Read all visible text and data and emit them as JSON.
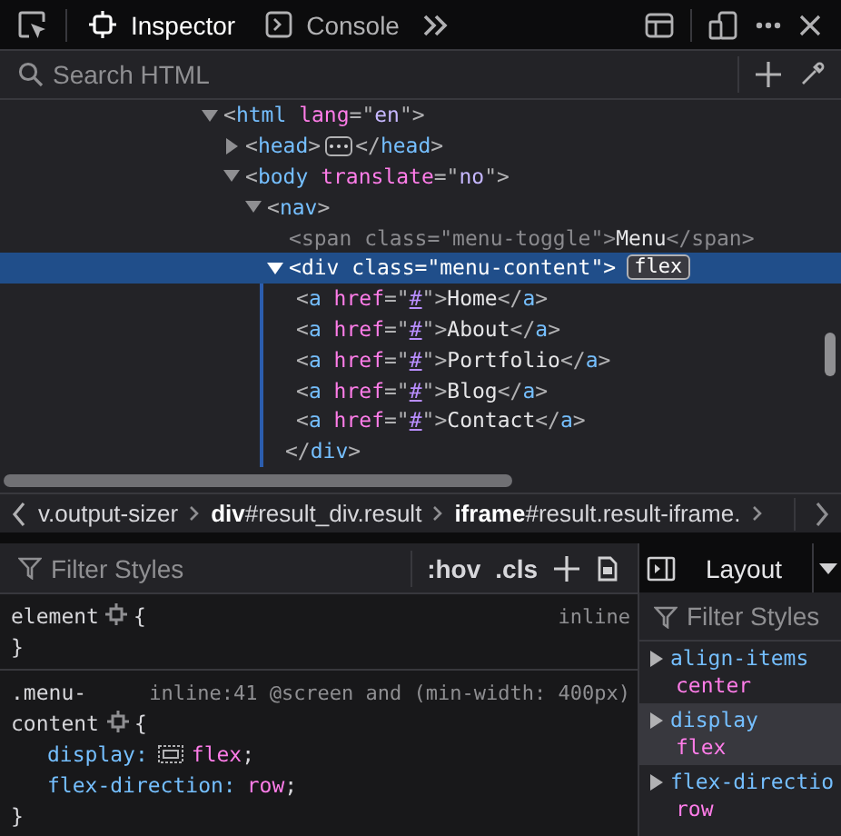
{
  "toolbar": {
    "tabs": [
      {
        "label": "Inspector",
        "selected": true
      },
      {
        "label": "Console",
        "selected": false
      }
    ]
  },
  "search": {
    "placeholder": "Search HTML"
  },
  "markup": {
    "nodes": [
      {
        "tokens": [
          {
            "kind": "p",
            "text": "<"
          },
          {
            "kind": "tag",
            "text": "html"
          },
          {
            "kind": "attr",
            "text": "lang"
          },
          {
            "kind": "p",
            "text": "=\""
          },
          {
            "kind": "val",
            "text": "en"
          },
          {
            "kind": "p",
            "text": "\">"
          }
        ],
        "expanded": true,
        "selected": false,
        "dimmed": false,
        "children": [
          {
            "tokens": [
              {
                "kind": "p",
                "text": "<"
              },
              {
                "kind": "tag",
                "text": "head"
              },
              {
                "kind": "p",
                "text": ">"
              }
            ],
            "closing": [
              {
                "kind": "p",
                "text": "</"
              },
              {
                "kind": "tag",
                "text": "head"
              },
              {
                "kind": "p",
                "text": ">"
              }
            ],
            "expanded": false,
            "selected": false,
            "dimmed": false
          },
          {
            "tokens": [
              {
                "kind": "p",
                "text": "<"
              },
              {
                "kind": "tag",
                "text": "body"
              },
              {
                "kind": "attr",
                "text": "translate"
              },
              {
                "kind": "p",
                "text": "=\""
              },
              {
                "kind": "val",
                "text": "no"
              },
              {
                "kind": "p",
                "text": "\">"
              }
            ],
            "expanded": true,
            "selected": false,
            "dimmed": false,
            "children": [
              {
                "tokens": [
                  {
                    "kind": "p",
                    "text": "<"
                  },
                  {
                    "kind": "tag",
                    "text": "nav"
                  },
                  {
                    "kind": "p",
                    "text": ">"
                  }
                ],
                "expanded": true,
                "selected": false,
                "dimmed": false,
                "children": [
                  {
                    "tokens": [
                      {
                        "kind": "p",
                        "text": "<"
                      },
                      {
                        "kind": "tag",
                        "text": "span"
                      },
                      {
                        "kind": "attr",
                        "text": "class"
                      },
                      {
                        "kind": "p",
                        "text": "=\""
                      },
                      {
                        "kind": "val",
                        "text": "menu-toggle"
                      },
                      {
                        "kind": "p",
                        "text": "\">"
                      },
                      {
                        "kind": "text",
                        "text": "Menu"
                      },
                      {
                        "kind": "p",
                        "text": "</"
                      },
                      {
                        "kind": "tag",
                        "text": "span"
                      },
                      {
                        "kind": "p",
                        "text": ">"
                      }
                    ],
                    "selected": false,
                    "dimmed": true
                  },
                  {
                    "tokens": [
                      {
                        "kind": "p",
                        "text": "<"
                      },
                      {
                        "kind": "tag",
                        "text": "div"
                      },
                      {
                        "kind": "attr",
                        "text": "class"
                      },
                      {
                        "kind": "p",
                        "text": "=\""
                      },
                      {
                        "kind": "val",
                        "text": "menu-content"
                      },
                      {
                        "kind": "p",
                        "text": "\">"
                      }
                    ],
                    "closing": [
                      {
                        "kind": "p",
                        "text": "</"
                      },
                      {
                        "kind": "tag",
                        "text": "div"
                      },
                      {
                        "kind": "p",
                        "text": ">"
                      }
                    ],
                    "badge": "flex",
                    "expanded": true,
                    "selected": true,
                    "dimmed": false,
                    "children": [
                      {
                        "tokens": [
                          {
                            "kind": "p",
                            "text": "<"
                          },
                          {
                            "kind": "tag",
                            "text": "a"
                          },
                          {
                            "kind": "attr",
                            "text": "href"
                          },
                          {
                            "kind": "p",
                            "text": "=\""
                          },
                          {
                            "kind": "link",
                            "text": "#"
                          },
                          {
                            "kind": "p",
                            "text": "\">"
                          },
                          {
                            "kind": "text",
                            "text": "Home"
                          },
                          {
                            "kind": "p",
                            "text": "</"
                          },
                          {
                            "kind": "tag",
                            "text": "a"
                          },
                          {
                            "kind": "p",
                            "text": ">"
                          }
                        ],
                        "selected": false,
                        "dimmed": false
                      },
                      {
                        "tokens": [
                          {
                            "kind": "p",
                            "text": "<"
                          },
                          {
                            "kind": "tag",
                            "text": "a"
                          },
                          {
                            "kind": "attr",
                            "text": "href"
                          },
                          {
                            "kind": "p",
                            "text": "=\""
                          },
                          {
                            "kind": "link",
                            "text": "#"
                          },
                          {
                            "kind": "p",
                            "text": "\">"
                          },
                          {
                            "kind": "text",
                            "text": "About"
                          },
                          {
                            "kind": "p",
                            "text": "</"
                          },
                          {
                            "kind": "tag",
                            "text": "a"
                          },
                          {
                            "kind": "p",
                            "text": ">"
                          }
                        ],
                        "selected": false,
                        "dimmed": false
                      },
                      {
                        "tokens": [
                          {
                            "kind": "p",
                            "text": "<"
                          },
                          {
                            "kind": "tag",
                            "text": "a"
                          },
                          {
                            "kind": "attr",
                            "text": "href"
                          },
                          {
                            "kind": "p",
                            "text": "=\""
                          },
                          {
                            "kind": "link",
                            "text": "#"
                          },
                          {
                            "kind": "p",
                            "text": "\">"
                          },
                          {
                            "kind": "text",
                            "text": "Portfolio"
                          },
                          {
                            "kind": "p",
                            "text": "</"
                          },
                          {
                            "kind": "tag",
                            "text": "a"
                          },
                          {
                            "kind": "p",
                            "text": ">"
                          }
                        ],
                        "selected": false,
                        "dimmed": false
                      },
                      {
                        "tokens": [
                          {
                            "kind": "p",
                            "text": "<"
                          },
                          {
                            "kind": "tag",
                            "text": "a"
                          },
                          {
                            "kind": "attr",
                            "text": "href"
                          },
                          {
                            "kind": "p",
                            "text": "=\""
                          },
                          {
                            "kind": "link",
                            "text": "#"
                          },
                          {
                            "kind": "p",
                            "text": "\">"
                          },
                          {
                            "kind": "text",
                            "text": "Blog"
                          },
                          {
                            "kind": "p",
                            "text": "</"
                          },
                          {
                            "kind": "tag",
                            "text": "a"
                          },
                          {
                            "kind": "p",
                            "text": ">"
                          }
                        ],
                        "selected": false,
                        "dimmed": false
                      },
                      {
                        "tokens": [
                          {
                            "kind": "p",
                            "text": "<"
                          },
                          {
                            "kind": "tag",
                            "text": "a"
                          },
                          {
                            "kind": "attr",
                            "text": "href"
                          },
                          {
                            "kind": "p",
                            "text": "=\""
                          },
                          {
                            "kind": "link",
                            "text": "#"
                          },
                          {
                            "kind": "p",
                            "text": "\">"
                          },
                          {
                            "kind": "text",
                            "text": "Contact"
                          },
                          {
                            "kind": "p",
                            "text": "</"
                          },
                          {
                            "kind": "tag",
                            "text": "a"
                          },
                          {
                            "kind": "p",
                            "text": ">"
                          }
                        ],
                        "selected": false,
                        "dimmed": false
                      }
                    ]
                  }
                ]
              }
            ]
          }
        ]
      }
    ]
  },
  "breadcrumbs": [
    {
      "label": "v.output-sizer"
    },
    {
      "label": "**div**#result_div.result"
    },
    {
      "label": "**iframe**#result.result-iframe."
    }
  ],
  "rules": {
    "filter_placeholder": "Filter Styles",
    "buttons": [
      ":hov",
      ".cls"
    ],
    "rules": [
      {
        "selector": "element",
        "source": "inline",
        "open": "{",
        "close": "}"
      },
      {
        "selector": ".menu-content",
        "source": "inline:41 @screen and (min-width: 400px)",
        "open": "{",
        "close": "}",
        "declarations": [
          {
            "name": "display:",
            "value": "flex",
            "end": ";",
            "kind": "flex"
          },
          {
            "name": "flex-direction:",
            "value": "row",
            "end": ";",
            "kind": "plain"
          }
        ]
      }
    ]
  },
  "layout": {
    "tab": "Layout",
    "filter_placeholder": "Filter Styles",
    "properties": [
      {
        "name": "align-items",
        "value": "center",
        "expanded": false,
        "selected": false
      },
      {
        "name": "display",
        "value": "flex",
        "expanded": false,
        "selected": true
      },
      {
        "name": "flex-directio",
        "value": "row",
        "expanded": false,
        "selected": false
      }
    ]
  }
}
